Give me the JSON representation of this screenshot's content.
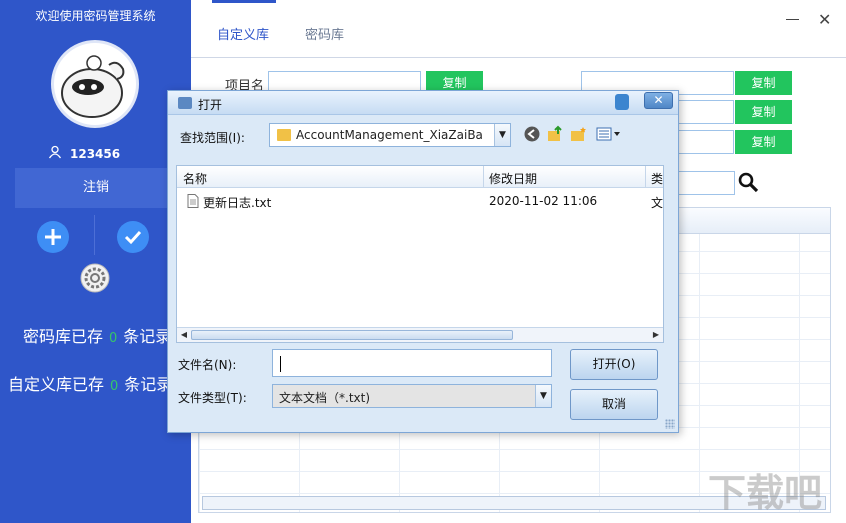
{
  "app": {
    "title": "欢迎使用密码管理系统",
    "username": "123456",
    "logout_label": "注销",
    "stats": [
      {
        "prefix": "密码库已存",
        "count": "0",
        "suffix": "条记录"
      },
      {
        "prefix": "自定义库已存",
        "count": "0",
        "suffix": "条记录"
      }
    ]
  },
  "tabs": [
    {
      "label": "自定义库"
    },
    {
      "label": "密码库"
    }
  ],
  "form": {
    "project_label": "项目名",
    "copy_label": "复制"
  },
  "dialog": {
    "title": "打开",
    "close_label": "✕",
    "lookin_label": "查找范围(I):",
    "lookin_value": "AccountManagement_XiaZaiBa",
    "columns": [
      "名称",
      "修改日期",
      "类"
    ],
    "files": [
      {
        "name": "更新日志.txt",
        "date": "2020-11-02 11:06",
        "type": "文"
      }
    ],
    "filename_label": "文件名(N):",
    "filename_value": "",
    "filetype_label": "文件类型(T):",
    "filetype_value": "文本文档（*.txt)",
    "open_label": "打开(O)",
    "cancel_label": "取消"
  },
  "watermark": "下载吧",
  "colors": {
    "sidebar": "#2f56c9",
    "copy_button": "#22c55e",
    "accent": "#2f56c9"
  }
}
